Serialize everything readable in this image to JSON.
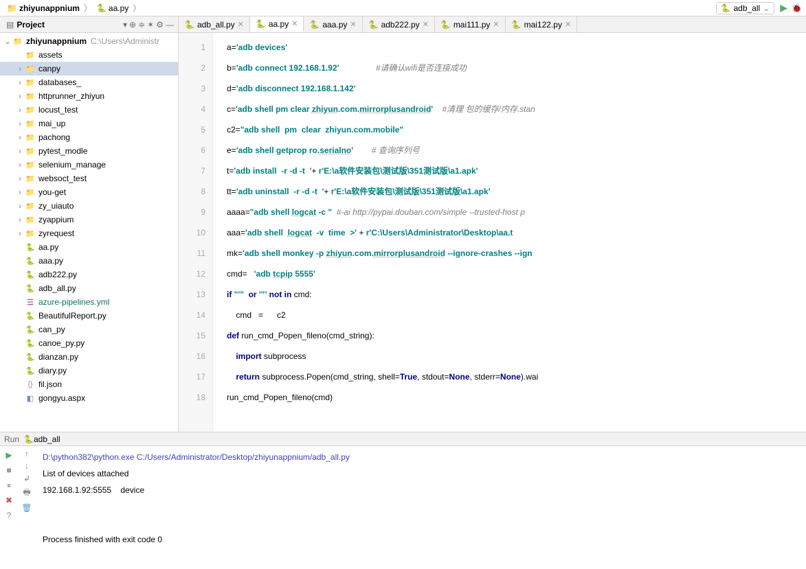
{
  "breadcrumb": {
    "root": "zhiyunappnium",
    "file": "aa.py"
  },
  "run_config": {
    "name": "adb_all"
  },
  "project_panel": {
    "title": "Project",
    "root": {
      "name": "zhiyunappnium",
      "path": "C:\\Users\\Administr"
    },
    "items": [
      {
        "type": "folder",
        "name": "assets",
        "depth": 1,
        "expandable": false
      },
      {
        "type": "folder",
        "name": "canpy",
        "depth": 1,
        "expandable": true,
        "selected": true
      },
      {
        "type": "folder",
        "name": "databases_",
        "depth": 1,
        "expandable": true
      },
      {
        "type": "folder",
        "name": "httprunner_zhiyun",
        "depth": 1,
        "expandable": true
      },
      {
        "type": "folder",
        "name": "locust_test",
        "depth": 1,
        "expandable": true
      },
      {
        "type": "folder",
        "name": "mai_up",
        "depth": 1,
        "expandable": true
      },
      {
        "type": "folder",
        "name": "pachong",
        "depth": 1,
        "expandable": true
      },
      {
        "type": "folder",
        "name": "pytest_modle",
        "depth": 1,
        "expandable": true
      },
      {
        "type": "folder",
        "name": "selenium_manage",
        "depth": 1,
        "expandable": true
      },
      {
        "type": "folder",
        "name": "websoct_test",
        "depth": 1,
        "expandable": true
      },
      {
        "type": "folder",
        "name": "you-get",
        "depth": 1,
        "expandable": true
      },
      {
        "type": "folder",
        "name": "zy_uiauto",
        "depth": 1,
        "expandable": true
      },
      {
        "type": "folder",
        "name": "zyappium",
        "depth": 1,
        "expandable": true
      },
      {
        "type": "folder",
        "name": "zyrequest",
        "depth": 1,
        "expandable": true
      },
      {
        "type": "py",
        "name": "aa.py",
        "depth": 1
      },
      {
        "type": "py",
        "name": "aaa.py",
        "depth": 1
      },
      {
        "type": "py",
        "name": "adb222.py",
        "depth": 1
      },
      {
        "type": "py",
        "name": "adb_all.py",
        "depth": 1
      },
      {
        "type": "yml",
        "name": "azure-pipelines.yml",
        "depth": 1
      },
      {
        "type": "py",
        "name": "BeautifulReport.py",
        "depth": 1
      },
      {
        "type": "py",
        "name": "can_py",
        "depth": 1
      },
      {
        "type": "py",
        "name": "canoe_py.py",
        "depth": 1
      },
      {
        "type": "py",
        "name": "dianzan.py",
        "depth": 1
      },
      {
        "type": "py",
        "name": "diary.py",
        "depth": 1
      },
      {
        "type": "json",
        "name": "fil.json",
        "depth": 1
      },
      {
        "type": "aspx",
        "name": "gongyu.aspx",
        "depth": 1
      }
    ]
  },
  "tabs": [
    {
      "name": "adb_all.py",
      "active": false
    },
    {
      "name": "aa.py",
      "active": true
    },
    {
      "name": "aaa.py",
      "active": false
    },
    {
      "name": "adb222.py",
      "active": false
    },
    {
      "name": "mai111.py",
      "active": false
    },
    {
      "name": "mai122.py",
      "active": false
    }
  ],
  "code_lines": [
    {
      "n": 1,
      "html": "a=<span class='str'>'adb devices'</span>"
    },
    {
      "n": 2,
      "html": "b=<span class='str'>'adb connect 192.168.1.92'</span>                <span class='cmt'>#请确认wifi是否连接成功</span>"
    },
    {
      "n": 3,
      "html": "d=<span class='str'>'adb disconnect 192.168.1.142'</span>"
    },
    {
      "n": 4,
      "html": "c=<span class='str'>'adb shell pm clear <span class='under'>zhiyun</span>.com.<span class='under'>mirrorplusandroid</span>'</span>    <span class='cmt'>#清理 包的缓存/内存.stan</span>"
    },
    {
      "n": 5,
      "html": "c2=<span class='str'>\"adb shell  pm  clear  zhiyun.com.mobile\"</span>"
    },
    {
      "n": 6,
      "html": "e=<span class='str'>'adb shell getprop ro.<span class='under'>serialno</span>'</span>        <span class='cmt'># 查询序列号</span>"
    },
    {
      "n": 7,
      "html": "t=<span class='str'>'adb install  -r -d -t  '</span>+ <span class='str'>r'E:\\a软件安装包\\测试版\\351测试版\\a1.apk'</span>"
    },
    {
      "n": 8,
      "html": "tt=<span class='str'>'adb uninstall  -r -d -t  '</span>+ <span class='str'>r'E:\\a软件安装包\\测试版\\351测试版\\a1.apk'</span>"
    },
    {
      "n": 9,
      "html": "aaaa=<span class='str'>\"adb shell <span class='under'>logcat</span> -c \"</span>  <span class='cmt'>#-ai http://pypai.douban.com/simple --trusted-host p</span>"
    },
    {
      "n": 10,
      "html": "aaa=<span class='str'>'adb shell  <span class='under'>logcat</span>  -v  time  &gt;'</span> + <span class='str'>r'C:\\Users\\Administrator\\Desktop\\aa.t</span>"
    },
    {
      "n": 11,
      "html": "mk=<span class='str'>'adb shell monkey -p <span class='under'>zhiyun</span>.com.<span class='under'>mirrorplusandroid</span> --ignore-crashes --ign</span>"
    },
    {
      "n": 12,
      "html": "cmd=   <span class='str'>'adb <span class='under'>tcpip</span> 5555'</span>"
    },
    {
      "n": 13,
      "html": "<span class='kw'>if </span><span class='str'>\"'\"</span>  <span class='kw'>or</span> <span class='str'>'\"'</span> <span class='kw'>not in</span> cmd:"
    },
    {
      "n": 14,
      "html": "    cmd   =      c2"
    },
    {
      "n": 15,
      "html": "<span class='kw'>def </span><span class='fn'>run_cmd_Popen_fileno</span>(cmd_string):"
    },
    {
      "n": 16,
      "html": "    <span class='kw'>import </span>subprocess"
    },
    {
      "n": 17,
      "html": "    <span class='kw'>return </span>subprocess.Popen(cmd_string, <span class='op'>shell</span>=<span class='kw2'>True</span>, <span class='op'>stdout</span>=<span class='kw2'>None</span>, <span class='op'>stderr</span>=<span class='kw2'>None</span>).wai"
    },
    {
      "n": 18,
      "html": "run_cmd_Popen_fileno(cmd)"
    }
  ],
  "run_tool": {
    "label": "Run",
    "config": "adb_all"
  },
  "console_lines": [
    {
      "text": "D:\\python382\\python.exe C:/Users/Administrator/Desktop/zhiyunappnium/adb_all.py",
      "cls": "cmd-line"
    },
    {
      "text": "List of devices attached",
      "cls": ""
    },
    {
      "text": "192.168.1.92:5555    device",
      "cls": ""
    },
    {
      "text": "",
      "cls": ""
    },
    {
      "text": "",
      "cls": ""
    },
    {
      "text": "Process finished with exit code 0",
      "cls": ""
    }
  ]
}
